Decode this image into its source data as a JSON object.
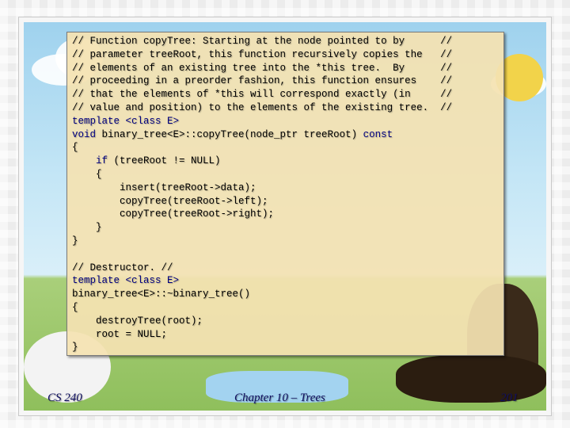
{
  "code": {
    "comment_lines": [
      "// Function copyTree: Starting at the node pointed to by      //",
      "// parameter treeRoot, this function recursively copies the   //",
      "// elements of an existing tree into the *this tree.  By      //",
      "// proceeding in a preorder fashion, this function ensures    //",
      "// that the elements of *this will correspond exactly (in     //",
      "// value and position) to the elements of the existing tree.  //"
    ],
    "copy_template": "template <class E>",
    "copy_signature_prefix": "void ",
    "copy_signature_rest": "binary_tree<E>::copyTree(node_ptr treeRoot) ",
    "copy_signature_const": "const",
    "open_brace_1": "{",
    "if_keyword": "    if",
    "if_condition": " (treeRoot != NULL)",
    "open_brace_2": "    {",
    "body_line_1": "        insert(treeRoot->data);",
    "body_line_2": "        copyTree(treeRoot->left);",
    "body_line_3": "        copyTree(treeRoot->right);",
    "close_brace_2": "    }",
    "close_brace_1": "}",
    "destructor_comment": "// Destructor. //",
    "destructor_template": "template <class E>",
    "destructor_signature": "binary_tree<E>::~binary_tree()",
    "open_brace_3": "{",
    "destructor_line_1": "    destroyTree(root);",
    "destructor_line_2": "    root = NULL;",
    "close_brace_3": "}"
  },
  "footer": {
    "course": "CS 240",
    "chapter": "Chapter 10 – Trees",
    "page_number": "201"
  }
}
